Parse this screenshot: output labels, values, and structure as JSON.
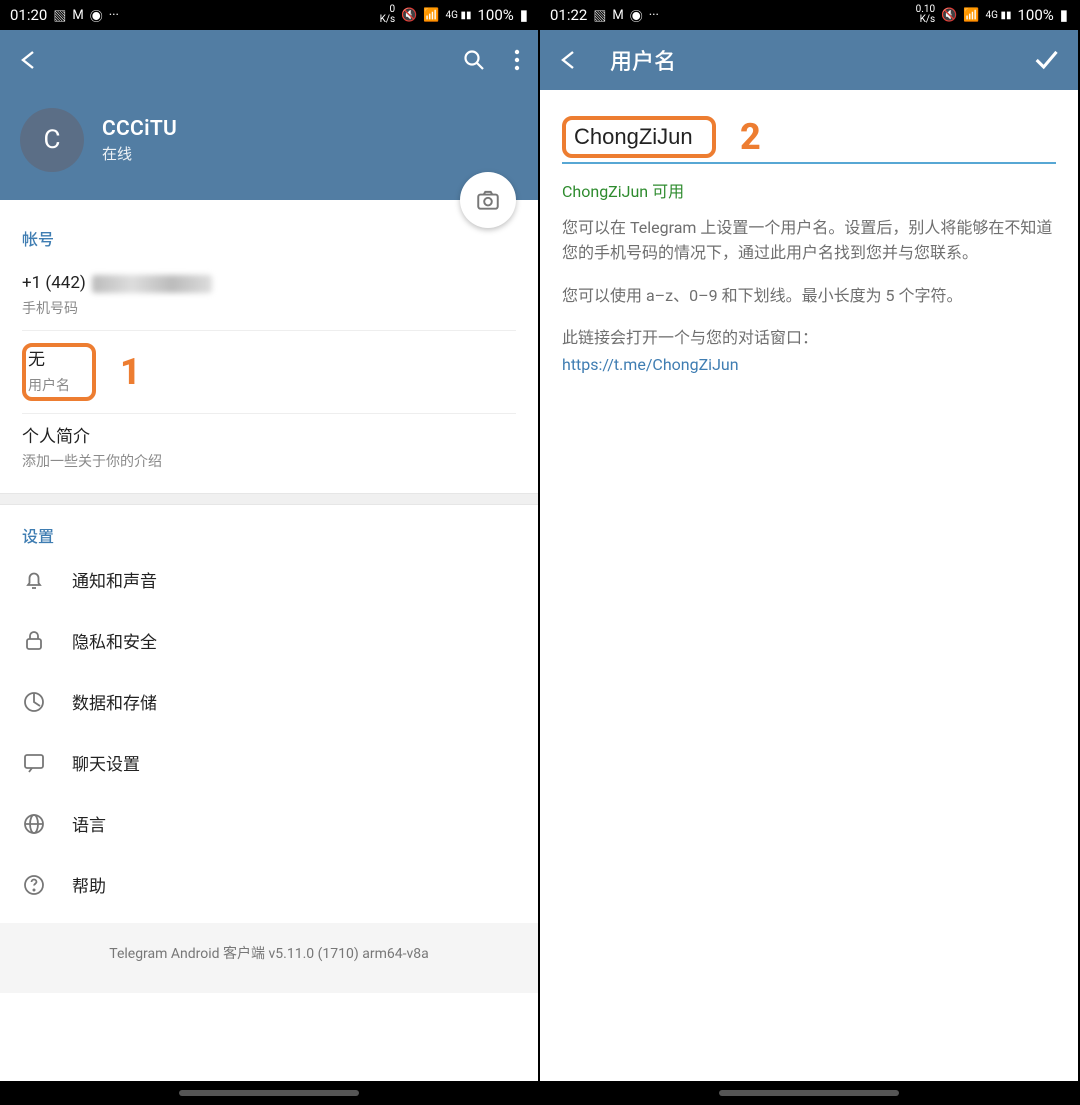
{
  "left": {
    "status": {
      "time": "01:20",
      "net": "0\nK/s",
      "batt": "100%"
    },
    "profile": {
      "initial": "C",
      "name": "CCCiTU",
      "status": "在线"
    },
    "account_section": "帐号",
    "phone_prefix": "+1 (442)",
    "phone_label": "手机号码",
    "username_value": "无",
    "username_label": "用户名",
    "bio_title": "个人简介",
    "bio_sub": "添加一些关于你的介绍",
    "settings_title": "设置",
    "settings": {
      "notify": "通知和声音",
      "privacy": "隐私和安全",
      "data": "数据和存储",
      "chat": "聊天设置",
      "lang": "语言",
      "help": "帮助"
    },
    "version": "Telegram Android 客户端 v5.11.0 (1710) arm64-v8a",
    "callout": "1"
  },
  "right": {
    "status": {
      "time": "01:22",
      "net": "0.10\nK/s",
      "batt": "100%"
    },
    "header_title": "用户名",
    "input_value": "ChongZiJun",
    "avail": "ChongZiJun 可用",
    "desc1": "您可以在 Telegram 上设置一个用户名。设置后，别人将能够在不知道您的手机号码的情况下，通过此用户名找到您并与您联系。",
    "desc2": "您可以使用 a–z、0–9 和下划线。最小长度为 5 个字符。",
    "desc3": "此链接会打开一个与您的对话窗口：",
    "link": "https://t.me/ChongZiJun",
    "callout": "2"
  }
}
